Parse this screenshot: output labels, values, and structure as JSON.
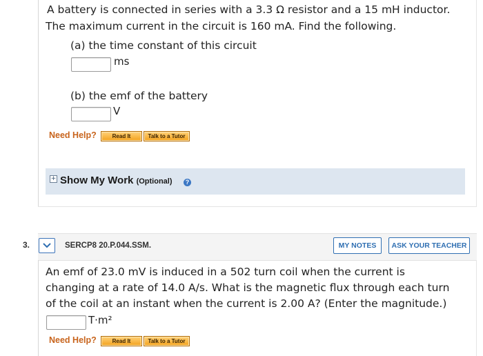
{
  "q2": {
    "intro_line1": "A battery is connected in series with a 3.3 Ω resistor and a 15 mH inductor.",
    "intro_line2": "The maximum current in the circuit is 160 mA. Find the following.",
    "part_a": {
      "label": "(a) the time constant of this circuit",
      "unit": "ms",
      "value": ""
    },
    "part_b": {
      "label": "(b) the emf of the battery",
      "unit": "V",
      "value": ""
    },
    "need_help": "Need Help?",
    "read_it": "Read It",
    "talk_tutor": "Talk to a Tutor",
    "show_my_work": {
      "toggle": "+",
      "title": "Show My Work",
      "optional": "(Optional)",
      "help_icon": "?"
    }
  },
  "q3": {
    "number": "3.",
    "code": "SERCP8 20.P.044.SSM.",
    "my_notes": "MY NOTES",
    "ask_teacher": "ASK YOUR TEACHER",
    "text_line1": "An emf of 23.0 mV is induced in a 502 turn coil when the current is",
    "text_line2": "changing at a rate of 14.0 A/s. What is the magnetic flux through each turn",
    "text_line3": "of the coil at an instant when the current is 2.00 A? (Enter the magnitude.)",
    "unit": "T·m²",
    "value": "",
    "need_help": "Need Help?",
    "read_it": "Read It",
    "talk_tutor": "Talk to a Tutor"
  },
  "colors": {
    "accent": "#2f6fb2",
    "need_help": "#c8641c",
    "button_fill": "#f3a11c",
    "panel": "#dde6f0"
  }
}
